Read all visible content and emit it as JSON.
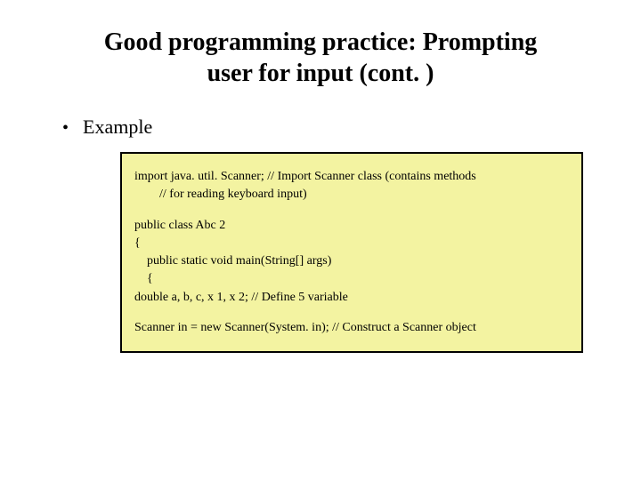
{
  "title_line1": "Good programming practice: Prompting",
  "title_line2": "user for input (cont. )",
  "bullet_text": "Example",
  "code": {
    "l1": "import java. util. Scanner;   // Import Scanner class (contains methods",
    "l2": "// for reading keyboard input)",
    "l3": "public class Abc 2",
    "l4": "{",
    "l5": "public static void main(String[] args)",
    "l6": "{",
    "l7": "double a, b, c, x 1, x 2;   // Define 5 variable",
    "l8": "Scanner in = new Scanner(System. in);   // Construct a Scanner object"
  }
}
